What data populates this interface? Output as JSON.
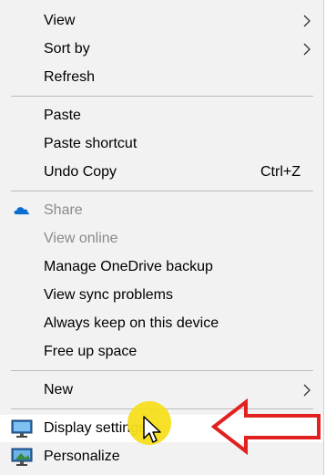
{
  "menu": {
    "items": [
      {
        "label": "View",
        "submenu": true
      },
      {
        "label": "Sort by",
        "submenu": true
      },
      {
        "label": "Refresh"
      },
      {
        "label": "Paste"
      },
      {
        "label": "Paste shortcut"
      },
      {
        "label": "Undo Copy",
        "shortcut": "Ctrl+Z"
      },
      {
        "label": "Share",
        "icon": "onedrive-cloud-icon",
        "disabled": true
      },
      {
        "label": "View online",
        "disabled": true
      },
      {
        "label": "Manage OneDrive backup"
      },
      {
        "label": "View sync problems"
      },
      {
        "label": "Always keep on this device"
      },
      {
        "label": "Free up space"
      },
      {
        "label": "New",
        "submenu": true
      },
      {
        "label": "Display settings",
        "icon": "display-monitor-icon"
      },
      {
        "label": "Personalize",
        "icon": "personalize-monitor-icon"
      }
    ]
  },
  "colors": {
    "menu_background": "#f2f2f2",
    "hover_background": "#ffffff",
    "disabled_text": "#8a8a8a",
    "onedrive_blue": "#0a6ed1",
    "click_highlight": "#f6de1c",
    "annotation_arrow": "#e0211f"
  },
  "annotations": {
    "click_highlight": "yellow-circle",
    "pointer_arrow": "red-outline-arrow-pointing-left"
  }
}
